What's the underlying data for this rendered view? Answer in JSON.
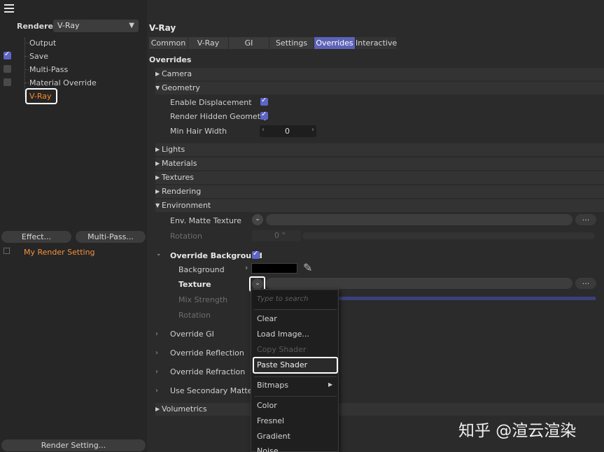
{
  "left_panel": {
    "renderer_label": "Renderer",
    "renderer_value": "V-Ray",
    "tree": [
      {
        "label": "Output",
        "checkbox": "none"
      },
      {
        "label": "Save",
        "checkbox": "checked"
      },
      {
        "label": "Multi-Pass",
        "checkbox": "unchecked"
      },
      {
        "label": "Material Override",
        "checkbox": "unchecked"
      },
      {
        "label": "V-Ray",
        "checkbox": "none"
      }
    ],
    "effect_button": "Effect...",
    "multipass_button": "Multi-Pass...",
    "setting_name": "My Render Setting",
    "render_setting_button": "Render Setting..."
  },
  "right_panel": {
    "title": "V-Ray",
    "tabs": [
      "Common",
      "V-Ray",
      "GI",
      "Settings",
      "Overrides",
      "Interactive"
    ],
    "active_tab": "Overrides",
    "section_title": "Overrides",
    "groups": {
      "camera": "Camera",
      "geometry": "Geometry",
      "lights": "Lights",
      "materials": "Materials",
      "textures": "Textures",
      "rendering": "Rendering",
      "environment": "Environment",
      "volumetrics": "Volumetrics"
    },
    "geometry": {
      "enable_displacement": "Enable Displacement",
      "render_hidden_geometry": "Render Hidden Geometry",
      "min_hair_width": "Min Hair Width",
      "min_hair_width_value": "0"
    },
    "environment": {
      "env_matte_texture": "Env. Matte Texture",
      "rotation": "Rotation",
      "rotation_value": "0 °",
      "dots": "..."
    },
    "override_background": {
      "label": "Override Background",
      "background": "Background",
      "texture": "Texture",
      "mix_strength": "Mix Strength",
      "rotation": "Rotation",
      "dots": "..."
    },
    "override_rows": [
      "Override GI",
      "Override Reflection",
      "Override Refraction",
      "Use Secondary Matte"
    ]
  },
  "dropdown_menu": {
    "search_placeholder": "Type to search",
    "items": {
      "clear": "Clear",
      "load_image": "Load Image...",
      "copy_shader": "Copy Shader",
      "paste_shader": "Paste Shader",
      "bitmaps": "Bitmaps",
      "color": "Color",
      "fresnel": "Fresnel",
      "gradient": "Gradient",
      "noise": "Noise"
    }
  },
  "watermark": "知乎 @渲云渲染",
  "colors": {
    "accent_blue": "#5c63b7",
    "highlight_orange": "#ff8a1f",
    "checkbox_blue": "#5d66c6"
  }
}
